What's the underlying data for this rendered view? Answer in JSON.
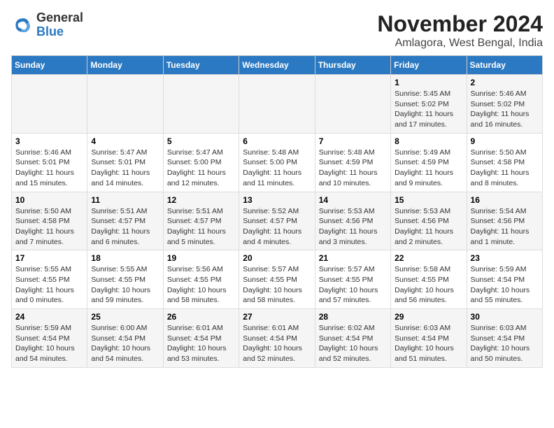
{
  "logo": {
    "general": "General",
    "blue": "Blue"
  },
  "header": {
    "month": "November 2024",
    "location": "Amlagora, West Bengal, India"
  },
  "weekdays": [
    "Sunday",
    "Monday",
    "Tuesday",
    "Wednesday",
    "Thursday",
    "Friday",
    "Saturday"
  ],
  "weeks": [
    [
      {
        "day": "",
        "detail": ""
      },
      {
        "day": "",
        "detail": ""
      },
      {
        "day": "",
        "detail": ""
      },
      {
        "day": "",
        "detail": ""
      },
      {
        "day": "",
        "detail": ""
      },
      {
        "day": "1",
        "detail": "Sunrise: 5:45 AM\nSunset: 5:02 PM\nDaylight: 11 hours and 17 minutes."
      },
      {
        "day": "2",
        "detail": "Sunrise: 5:46 AM\nSunset: 5:02 PM\nDaylight: 11 hours and 16 minutes."
      }
    ],
    [
      {
        "day": "3",
        "detail": "Sunrise: 5:46 AM\nSunset: 5:01 PM\nDaylight: 11 hours and 15 minutes."
      },
      {
        "day": "4",
        "detail": "Sunrise: 5:47 AM\nSunset: 5:01 PM\nDaylight: 11 hours and 14 minutes."
      },
      {
        "day": "5",
        "detail": "Sunrise: 5:47 AM\nSunset: 5:00 PM\nDaylight: 11 hours and 12 minutes."
      },
      {
        "day": "6",
        "detail": "Sunrise: 5:48 AM\nSunset: 5:00 PM\nDaylight: 11 hours and 11 minutes."
      },
      {
        "day": "7",
        "detail": "Sunrise: 5:48 AM\nSunset: 4:59 PM\nDaylight: 11 hours and 10 minutes."
      },
      {
        "day": "8",
        "detail": "Sunrise: 5:49 AM\nSunset: 4:59 PM\nDaylight: 11 hours and 9 minutes."
      },
      {
        "day": "9",
        "detail": "Sunrise: 5:50 AM\nSunset: 4:58 PM\nDaylight: 11 hours and 8 minutes."
      }
    ],
    [
      {
        "day": "10",
        "detail": "Sunrise: 5:50 AM\nSunset: 4:58 PM\nDaylight: 11 hours and 7 minutes."
      },
      {
        "day": "11",
        "detail": "Sunrise: 5:51 AM\nSunset: 4:57 PM\nDaylight: 11 hours and 6 minutes."
      },
      {
        "day": "12",
        "detail": "Sunrise: 5:51 AM\nSunset: 4:57 PM\nDaylight: 11 hours and 5 minutes."
      },
      {
        "day": "13",
        "detail": "Sunrise: 5:52 AM\nSunset: 4:57 PM\nDaylight: 11 hours and 4 minutes."
      },
      {
        "day": "14",
        "detail": "Sunrise: 5:53 AM\nSunset: 4:56 PM\nDaylight: 11 hours and 3 minutes."
      },
      {
        "day": "15",
        "detail": "Sunrise: 5:53 AM\nSunset: 4:56 PM\nDaylight: 11 hours and 2 minutes."
      },
      {
        "day": "16",
        "detail": "Sunrise: 5:54 AM\nSunset: 4:56 PM\nDaylight: 11 hours and 1 minute."
      }
    ],
    [
      {
        "day": "17",
        "detail": "Sunrise: 5:55 AM\nSunset: 4:55 PM\nDaylight: 11 hours and 0 minutes."
      },
      {
        "day": "18",
        "detail": "Sunrise: 5:55 AM\nSunset: 4:55 PM\nDaylight: 10 hours and 59 minutes."
      },
      {
        "day": "19",
        "detail": "Sunrise: 5:56 AM\nSunset: 4:55 PM\nDaylight: 10 hours and 58 minutes."
      },
      {
        "day": "20",
        "detail": "Sunrise: 5:57 AM\nSunset: 4:55 PM\nDaylight: 10 hours and 58 minutes."
      },
      {
        "day": "21",
        "detail": "Sunrise: 5:57 AM\nSunset: 4:55 PM\nDaylight: 10 hours and 57 minutes."
      },
      {
        "day": "22",
        "detail": "Sunrise: 5:58 AM\nSunset: 4:55 PM\nDaylight: 10 hours and 56 minutes."
      },
      {
        "day": "23",
        "detail": "Sunrise: 5:59 AM\nSunset: 4:54 PM\nDaylight: 10 hours and 55 minutes."
      }
    ],
    [
      {
        "day": "24",
        "detail": "Sunrise: 5:59 AM\nSunset: 4:54 PM\nDaylight: 10 hours and 54 minutes."
      },
      {
        "day": "25",
        "detail": "Sunrise: 6:00 AM\nSunset: 4:54 PM\nDaylight: 10 hours and 54 minutes."
      },
      {
        "day": "26",
        "detail": "Sunrise: 6:01 AM\nSunset: 4:54 PM\nDaylight: 10 hours and 53 minutes."
      },
      {
        "day": "27",
        "detail": "Sunrise: 6:01 AM\nSunset: 4:54 PM\nDaylight: 10 hours and 52 minutes."
      },
      {
        "day": "28",
        "detail": "Sunrise: 6:02 AM\nSunset: 4:54 PM\nDaylight: 10 hours and 52 minutes."
      },
      {
        "day": "29",
        "detail": "Sunrise: 6:03 AM\nSunset: 4:54 PM\nDaylight: 10 hours and 51 minutes."
      },
      {
        "day": "30",
        "detail": "Sunrise: 6:03 AM\nSunset: 4:54 PM\nDaylight: 10 hours and 50 minutes."
      }
    ]
  ]
}
